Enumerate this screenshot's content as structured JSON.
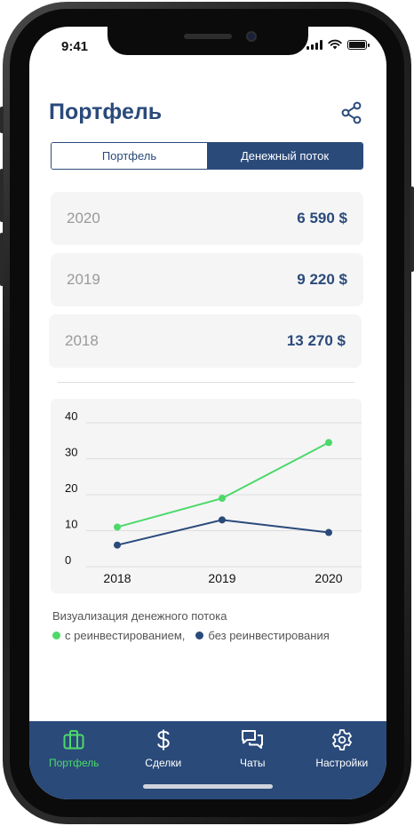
{
  "status_bar": {
    "time": "9:41"
  },
  "header": {
    "title": "Портфель",
    "share_icon": "share-icon"
  },
  "segmented": {
    "tabs": [
      {
        "label": "Портфель",
        "active": false
      },
      {
        "label": "Денежный поток",
        "active": true
      }
    ]
  },
  "years": [
    {
      "year": "2020",
      "amount": "6 590 $"
    },
    {
      "year": "2019",
      "amount": "9 220 $"
    },
    {
      "year": "2018",
      "amount": "13 270 $"
    }
  ],
  "chart_data": {
    "type": "line",
    "x": [
      "2018",
      "2019",
      "2020"
    ],
    "y_ticks": [
      "40",
      "30",
      "20",
      "10",
      "0"
    ],
    "ylim": [
      0,
      40
    ],
    "grid": true,
    "series": [
      {
        "name": "с реинвестированием,",
        "color": "#4cd96a",
        "values": [
          11,
          19,
          34.5
        ]
      },
      {
        "name": "без реинвестирования",
        "color": "#2a4a7a",
        "values": [
          6,
          13,
          9.5
        ]
      }
    ]
  },
  "legend": {
    "title": "Визуализация денежного потока",
    "items": [
      {
        "label": "с реинвестированием,",
        "color": "#4cd96a"
      },
      {
        "label": "без реинвестирования",
        "color": "#2a4a7a"
      }
    ]
  },
  "tabbar": {
    "items": [
      {
        "label": "Портфель",
        "icon": "briefcase-icon",
        "active": true
      },
      {
        "label": "Сделки",
        "icon": "dollar-icon",
        "active": false
      },
      {
        "label": "Чаты",
        "icon": "chat-icon",
        "active": false
      },
      {
        "label": "Настройки",
        "icon": "gear-icon",
        "active": false
      }
    ]
  },
  "colors": {
    "primary": "#2a4a7a",
    "accent": "#4cd96a",
    "card": "#f5f5f6"
  }
}
